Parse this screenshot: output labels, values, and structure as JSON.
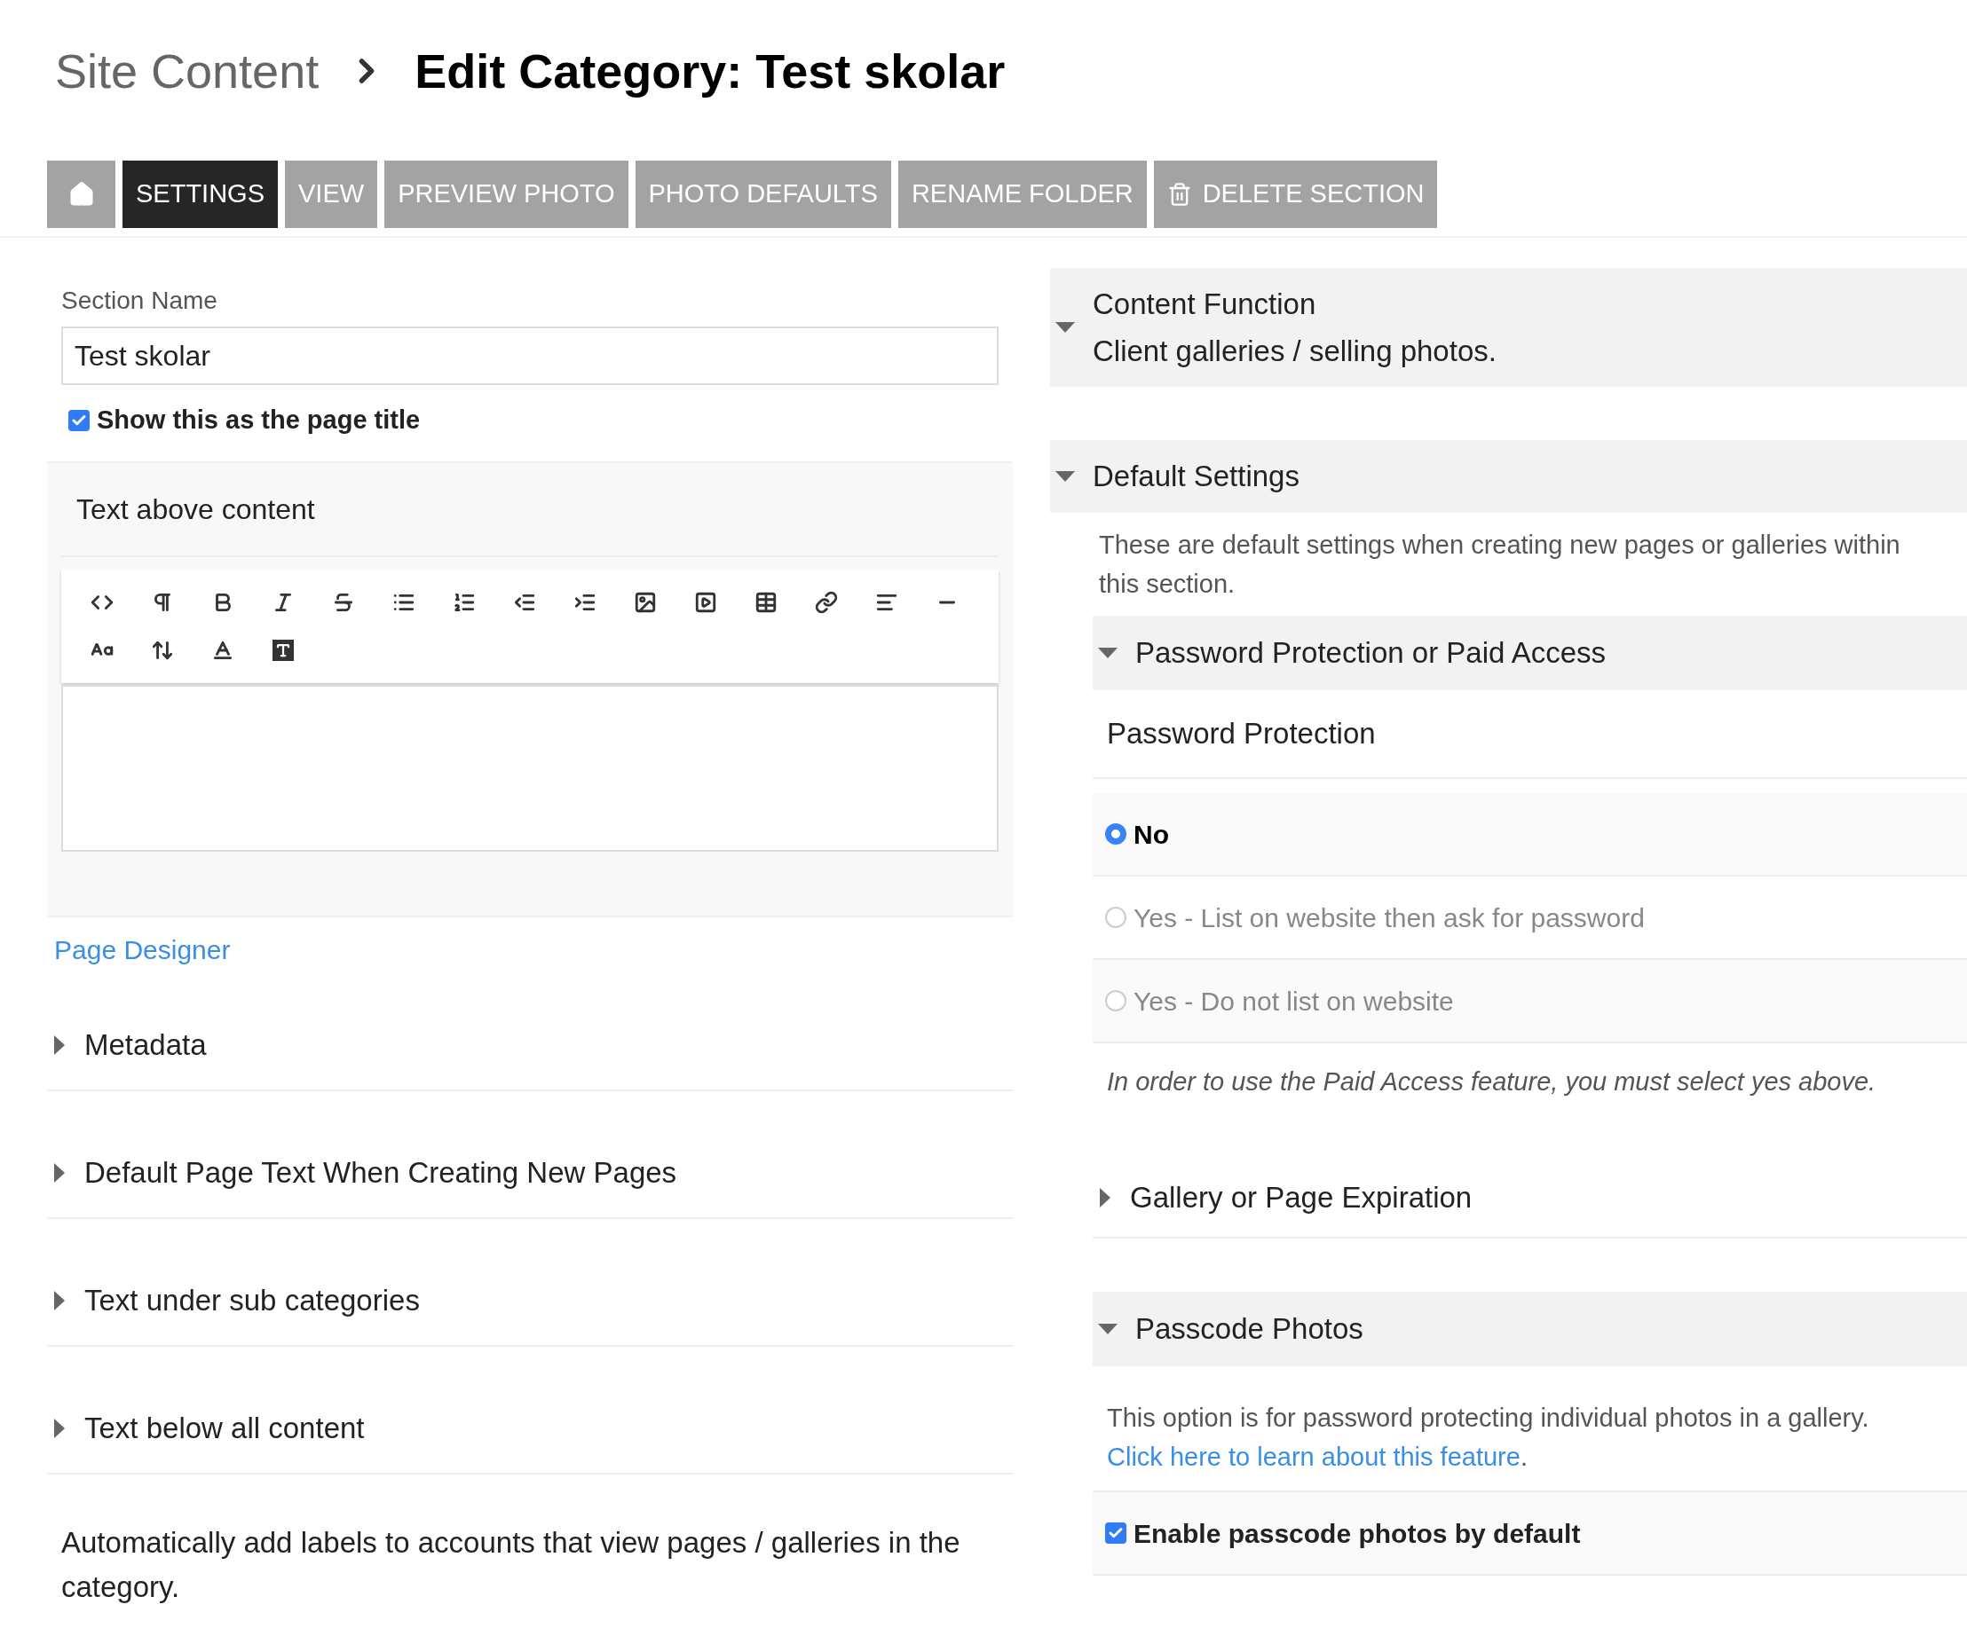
{
  "breadcrumb": {
    "parent": "Site Content",
    "current": "Edit Category: Test skolar"
  },
  "tabs": [
    {
      "kind": "home",
      "selected": false
    },
    {
      "kind": "text",
      "label": "SETTINGS",
      "selected": true
    },
    {
      "kind": "text",
      "label": "VIEW",
      "selected": false
    },
    {
      "kind": "text",
      "label": "PREVIEW PHOTO",
      "selected": false
    },
    {
      "kind": "text",
      "label": "PHOTO DEFAULTS",
      "selected": false
    },
    {
      "kind": "text",
      "label": "RENAME FOLDER",
      "selected": false
    },
    {
      "kind": "delete",
      "label": "DELETE SECTION",
      "selected": false
    }
  ],
  "section_name": {
    "label": "Section Name",
    "value": "Test skolar"
  },
  "show_title": {
    "label": "Show this as the page title",
    "checked": true
  },
  "text_above": {
    "title": "Text above content"
  },
  "page_designer_link": "Page Designer",
  "left_sections": [
    {
      "title": "Metadata",
      "expanded": false
    },
    {
      "title": "Default Page Text When Creating New Pages",
      "expanded": false
    },
    {
      "title": "Text under sub categories",
      "expanded": false
    },
    {
      "title": "Text below all content",
      "expanded": false
    }
  ],
  "auto_labels": "Automatically add labels to accounts that view pages / galleries in the category.",
  "content_function": {
    "title": "Content Function",
    "value": "Client galleries / selling photos.",
    "expanded": true
  },
  "default_settings": {
    "title": "Default Settings",
    "expanded": true,
    "description": "These are default settings when creating new pages or galleries within this section.",
    "password": {
      "title": "Password Protection or Paid Access",
      "expanded": true,
      "heading": "Password Protection",
      "options": [
        {
          "label": "No",
          "selected": true
        },
        {
          "label": "Yes - List on website then ask for password",
          "selected": false
        },
        {
          "label": "Yes - Do not list on website",
          "selected": false
        }
      ],
      "note": "In order to use the Paid Access feature, you must select yes above."
    },
    "expiration": {
      "title": "Gallery or Page Expiration",
      "expanded": false
    },
    "passcode": {
      "title": "Passcode Photos",
      "expanded": true,
      "text": "This option is for password protecting individual photos in a gallery.",
      "link": "Click here to learn about this feature",
      "link_suffix": ".",
      "checkbox": {
        "label": "Enable passcode photos by default",
        "checked": true
      }
    }
  }
}
